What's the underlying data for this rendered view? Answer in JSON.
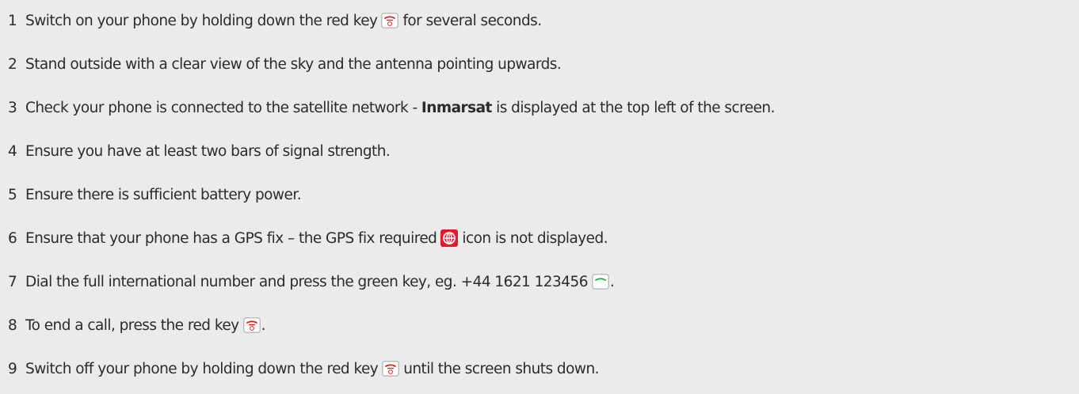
{
  "steps": [
    {
      "num": "1",
      "text": "Switch on your phone by holding down the red key",
      "after": "for several seconds.",
      "icon": "red-end-key-icon"
    },
    {
      "num": "2",
      "text": "Stand outside with a clear view of the sky and the antenna pointing upwards."
    },
    {
      "num": "3",
      "text": "Check your phone is connected to the satellite network - ",
      "bold": "Inmarsat",
      "after": " is displayed at the top left of the screen."
    },
    {
      "num": "4",
      "text": "Ensure you have at least two bars of signal strength."
    },
    {
      "num": "5",
      "text": "Ensure there is sufficient battery power."
    },
    {
      "num": "6",
      "text": "Ensure that your phone has a GPS fix – the GPS fix required",
      "after": "icon is not displayed.",
      "icon": "gps-fix-required-icon"
    },
    {
      "num": "7",
      "text": "Dial the full international number and press the green key, eg. +44 1621 123456",
      "after": ".",
      "icon": "green-call-key-icon"
    },
    {
      "num": "8",
      "text": "To end a call, press the red key",
      "after": ".",
      "icon": "red-end-key-icon"
    },
    {
      "num": "9",
      "text": "Switch off your phone by holding down the red key",
      "after": "until the screen shuts down.",
      "icon": "red-end-key-icon"
    }
  ],
  "colors": {
    "background": "#ebebeb",
    "text": "#2b2b2b",
    "red_key": "#e02020",
    "green_key": "#22aa44",
    "gps_icon": "#e8182c"
  }
}
